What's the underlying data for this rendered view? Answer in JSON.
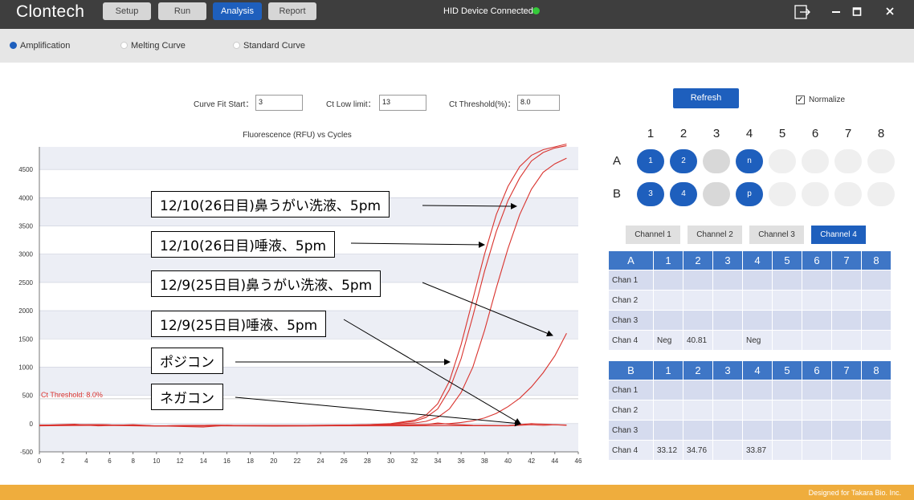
{
  "app": {
    "brand": "Clontech",
    "device_status": "HID Device Connected",
    "footer": "Designed for Takara Bio. Inc."
  },
  "toolbar": {
    "setup": "Setup",
    "run": "Run",
    "analysis": "Analysis",
    "report": "Report"
  },
  "window_icons": {
    "exit": "exit-icon",
    "minimize": "minimize-icon",
    "maximize": "maximize-icon",
    "close": "close-icon"
  },
  "views": {
    "amplification": "Amplification",
    "melting": "Melting Curve",
    "standard": "Standard Curve"
  },
  "params": {
    "curve_fit_label": "Curve Fit Start：",
    "curve_fit_value": "3",
    "ct_low_label": "Ct Low limit：",
    "ct_low_value": "13",
    "ct_threshold_label": "Ct Threshold(%)：",
    "ct_threshold_value": "8.0"
  },
  "refresh": "Refresh",
  "normalize": {
    "label": "Normalize",
    "checked": true
  },
  "plate": {
    "columns": [
      "1",
      "2",
      "3",
      "4",
      "5",
      "6",
      "7",
      "8"
    ],
    "rows": [
      "A",
      "B"
    ],
    "wells_A": [
      "1",
      "2",
      "",
      "n",
      "",
      "",
      "",
      ""
    ],
    "wells_B": [
      "3",
      "4",
      "",
      "p",
      "",
      "",
      "",
      ""
    ]
  },
  "channels": [
    "Channel 1",
    "Channel 2",
    "Channel 3",
    "Channel 4"
  ],
  "ct_table_A": {
    "header": [
      "A",
      "1",
      "2",
      "3",
      "4",
      "5",
      "6",
      "7",
      "8"
    ],
    "rows": [
      [
        "Chan 1",
        "",
        "",
        "",
        "",
        "",
        "",
        "",
        ""
      ],
      [
        "Chan 2",
        "",
        "",
        "",
        "",
        "",
        "",
        "",
        ""
      ],
      [
        "Chan 3",
        "",
        "",
        "",
        "",
        "",
        "",
        "",
        ""
      ],
      [
        "Chan 4",
        "Neg",
        "40.81",
        "",
        "Neg",
        "",
        "",
        "",
        ""
      ]
    ]
  },
  "ct_table_B": {
    "header": [
      "B",
      "1",
      "2",
      "3",
      "4",
      "5",
      "6",
      "7",
      "8"
    ],
    "rows": [
      [
        "Chan 1",
        "",
        "",
        "",
        "",
        "",
        "",
        "",
        ""
      ],
      [
        "Chan 2",
        "",
        "",
        "",
        "",
        "",
        "",
        "",
        ""
      ],
      [
        "Chan 3",
        "",
        "",
        "",
        "",
        "",
        "",
        "",
        ""
      ],
      [
        "Chan 4",
        "33.12",
        "34.76",
        "",
        "33.87",
        "",
        "",
        "",
        ""
      ]
    ]
  },
  "annotations": [
    "12/10(26日目)鼻うがい洗液、5pm",
    "12/10(26日目)唾液、5pm",
    "12/9(25日目)鼻うがい洗液、5pm",
    "12/9(25日目)唾液、5pm",
    "ポジコン",
    "ネガコン"
  ],
  "chart_data": {
    "type": "line",
    "title": "Fluorescence (RFU) vs Cycles",
    "xlim": [
      0,
      46
    ],
    "ylim": [
      -500,
      4900
    ],
    "xticks": [
      0,
      2,
      4,
      6,
      8,
      10,
      12,
      14,
      16,
      18,
      20,
      22,
      24,
      26,
      28,
      30,
      32,
      34,
      36,
      38,
      40,
      42,
      44,
      46
    ],
    "yticks": [
      -500,
      0,
      500,
      1000,
      1500,
      2000,
      2500,
      3000,
      3500,
      4000,
      4500
    ],
    "threshold": {
      "label": "Ct Threshold: 8.0%",
      "value": 440
    },
    "line_color": "#d9332e",
    "series": [
      {
        "x": [
          0,
          5,
          10,
          15,
          20,
          25,
          28,
          30,
          32,
          33,
          34,
          35,
          36,
          37,
          38,
          39,
          40,
          41,
          42,
          43,
          44,
          45
        ],
        "y": [
          -30,
          -20,
          -40,
          -30,
          -35,
          -30,
          -20,
          0,
          60,
          150,
          350,
          750,
          1400,
          2200,
          3000,
          3700,
          4200,
          4550,
          4750,
          4850,
          4900,
          4950
        ]
      },
      {
        "x": [
          0,
          5,
          10,
          15,
          20,
          25,
          28,
          30,
          32,
          33,
          34,
          35,
          36,
          37,
          38,
          39,
          40,
          41,
          42,
          43,
          44,
          45
        ],
        "y": [
          -30,
          -20,
          -40,
          -30,
          -35,
          -30,
          -20,
          -5,
          40,
          110,
          260,
          600,
          1150,
          1900,
          2700,
          3400,
          3950,
          4350,
          4650,
          4800,
          4880,
          4920
        ]
      },
      {
        "x": [
          0,
          5,
          10,
          15,
          20,
          25,
          28,
          30,
          32,
          33,
          34,
          35,
          36,
          37,
          38,
          39,
          40,
          41,
          42,
          43,
          44,
          45
        ],
        "y": [
          -30,
          -20,
          -40,
          -30,
          -35,
          -30,
          -25,
          -10,
          10,
          40,
          110,
          260,
          550,
          1000,
          1650,
          2400,
          3100,
          3700,
          4150,
          4450,
          4600,
          4700
        ]
      },
      {
        "x": [
          0,
          5,
          10,
          15,
          20,
          25,
          30,
          33,
          35,
          36,
          37,
          38,
          39,
          40,
          41,
          42,
          43,
          44,
          45
        ],
        "y": [
          -30,
          -20,
          -40,
          -30,
          -35,
          -30,
          -25,
          -15,
          0,
          20,
          50,
          100,
          180,
          300,
          450,
          650,
          900,
          1200,
          1600
        ]
      },
      {
        "x": [
          0,
          3,
          5,
          8,
          10,
          14,
          16,
          20,
          25,
          30,
          33,
          34,
          35,
          37,
          40,
          42,
          45
        ],
        "y": [
          -30,
          -10,
          -40,
          -20,
          -40,
          -60,
          -30,
          -40,
          -30,
          -25,
          -20,
          10,
          -10,
          -30,
          -35,
          0,
          -30
        ]
      },
      {
        "x": [
          0,
          5,
          10,
          15,
          20,
          25,
          30,
          35,
          40,
          42,
          43,
          44,
          45
        ],
        "y": [
          -40,
          -30,
          -45,
          -40,
          -45,
          -40,
          -40,
          -35,
          -40,
          -20,
          -30,
          -20,
          -25
        ]
      }
    ]
  }
}
